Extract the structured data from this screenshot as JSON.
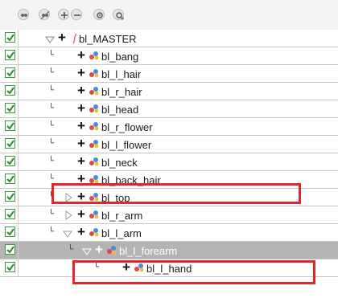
{
  "toolbar": {
    "icons": [
      "show-all-icon",
      "hide-all-icon",
      "expand-icon",
      "collapse-icon",
      "gear-icon",
      "gear-add-icon"
    ]
  },
  "layers": [
    {
      "name": "bl_MASTER",
      "icon": "master-peg-icon",
      "checked": true
    },
    {
      "name": "bl_bang",
      "icon": "drawing-peg-icon",
      "checked": true
    },
    {
      "name": "bl_l_hair",
      "icon": "drawing-peg-icon",
      "checked": true
    },
    {
      "name": "bl_r_hair",
      "icon": "drawing-peg-icon",
      "checked": true
    },
    {
      "name": "bl_head",
      "icon": "drawing-peg-icon",
      "checked": true
    },
    {
      "name": "bl_r_flower",
      "icon": "drawing-peg-icon",
      "checked": true
    },
    {
      "name": "bl_l_flower",
      "icon": "drawing-peg-icon",
      "checked": true
    },
    {
      "name": "bl_neck",
      "icon": "drawing-peg-icon",
      "checked": true
    },
    {
      "name": "bl_back_hair",
      "icon": "drawing-peg-icon",
      "checked": true
    },
    {
      "name": "bl_top",
      "icon": "drawing-peg-icon",
      "checked": true
    },
    {
      "name": "bl_r_arm",
      "icon": "drawing-peg-icon",
      "checked": true
    },
    {
      "name": "bl_l_arm",
      "icon": "drawing-peg-icon",
      "checked": true
    },
    {
      "name": "bl_l_forearm",
      "icon": "drawing-peg-icon",
      "checked": true,
      "selected": true
    },
    {
      "name": "bl_l_hand",
      "icon": "drawing-peg-icon",
      "checked": true
    }
  ],
  "colors": {
    "highlight_border": "#e3262b",
    "checkbox_green": "#3c9a3c",
    "selected_row": "#b4b4b4"
  }
}
